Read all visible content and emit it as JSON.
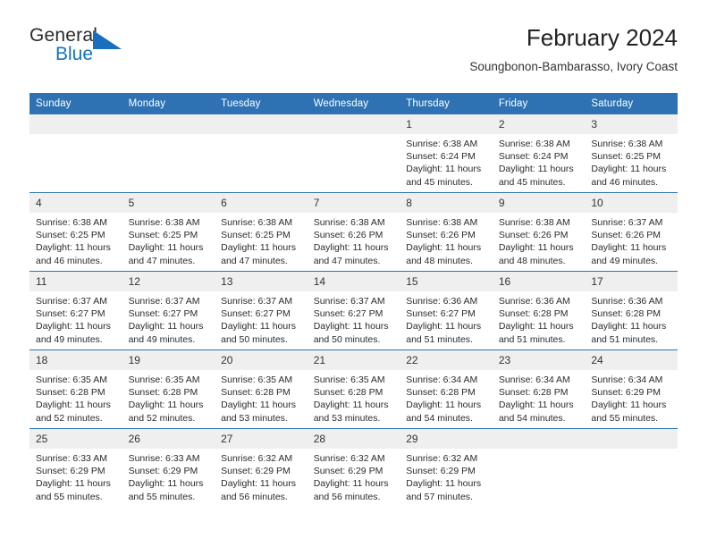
{
  "logo": {
    "word_one": "General",
    "word_two": "Blue",
    "accent_color": "#1a6fbd",
    "triangle_icon": "triangle-icon"
  },
  "header": {
    "title": "February 2024",
    "subtitle": "Soungbonon-Bambarasso, Ivory Coast"
  },
  "calendar": {
    "header_bg": "#2e72b3",
    "daynum_bg": "#efefef",
    "weekdays": [
      "Sunday",
      "Monday",
      "Tuesday",
      "Wednesday",
      "Thursday",
      "Friday",
      "Saturday"
    ],
    "weeks": [
      [
        {
          "day": "",
          "empty": true
        },
        {
          "day": "",
          "empty": true
        },
        {
          "day": "",
          "empty": true
        },
        {
          "day": "",
          "empty": true
        },
        {
          "day": "1",
          "sunrise": "Sunrise: 6:38 AM",
          "sunset": "Sunset: 6:24 PM",
          "daylight_l1": "Daylight: 11 hours",
          "daylight_l2": "and 45 minutes."
        },
        {
          "day": "2",
          "sunrise": "Sunrise: 6:38 AM",
          "sunset": "Sunset: 6:24 PM",
          "daylight_l1": "Daylight: 11 hours",
          "daylight_l2": "and 45 minutes."
        },
        {
          "day": "3",
          "sunrise": "Sunrise: 6:38 AM",
          "sunset": "Sunset: 6:25 PM",
          "daylight_l1": "Daylight: 11 hours",
          "daylight_l2": "and 46 minutes."
        }
      ],
      [
        {
          "day": "4",
          "sunrise": "Sunrise: 6:38 AM",
          "sunset": "Sunset: 6:25 PM",
          "daylight_l1": "Daylight: 11 hours",
          "daylight_l2": "and 46 minutes."
        },
        {
          "day": "5",
          "sunrise": "Sunrise: 6:38 AM",
          "sunset": "Sunset: 6:25 PM",
          "daylight_l1": "Daylight: 11 hours",
          "daylight_l2": "and 47 minutes."
        },
        {
          "day": "6",
          "sunrise": "Sunrise: 6:38 AM",
          "sunset": "Sunset: 6:25 PM",
          "daylight_l1": "Daylight: 11 hours",
          "daylight_l2": "and 47 minutes."
        },
        {
          "day": "7",
          "sunrise": "Sunrise: 6:38 AM",
          "sunset": "Sunset: 6:26 PM",
          "daylight_l1": "Daylight: 11 hours",
          "daylight_l2": "and 47 minutes."
        },
        {
          "day": "8",
          "sunrise": "Sunrise: 6:38 AM",
          "sunset": "Sunset: 6:26 PM",
          "daylight_l1": "Daylight: 11 hours",
          "daylight_l2": "and 48 minutes."
        },
        {
          "day": "9",
          "sunrise": "Sunrise: 6:38 AM",
          "sunset": "Sunset: 6:26 PM",
          "daylight_l1": "Daylight: 11 hours",
          "daylight_l2": "and 48 minutes."
        },
        {
          "day": "10",
          "sunrise": "Sunrise: 6:37 AM",
          "sunset": "Sunset: 6:26 PM",
          "daylight_l1": "Daylight: 11 hours",
          "daylight_l2": "and 49 minutes."
        }
      ],
      [
        {
          "day": "11",
          "sunrise": "Sunrise: 6:37 AM",
          "sunset": "Sunset: 6:27 PM",
          "daylight_l1": "Daylight: 11 hours",
          "daylight_l2": "and 49 minutes."
        },
        {
          "day": "12",
          "sunrise": "Sunrise: 6:37 AM",
          "sunset": "Sunset: 6:27 PM",
          "daylight_l1": "Daylight: 11 hours",
          "daylight_l2": "and 49 minutes."
        },
        {
          "day": "13",
          "sunrise": "Sunrise: 6:37 AM",
          "sunset": "Sunset: 6:27 PM",
          "daylight_l1": "Daylight: 11 hours",
          "daylight_l2": "and 50 minutes."
        },
        {
          "day": "14",
          "sunrise": "Sunrise: 6:37 AM",
          "sunset": "Sunset: 6:27 PM",
          "daylight_l1": "Daylight: 11 hours",
          "daylight_l2": "and 50 minutes."
        },
        {
          "day": "15",
          "sunrise": "Sunrise: 6:36 AM",
          "sunset": "Sunset: 6:27 PM",
          "daylight_l1": "Daylight: 11 hours",
          "daylight_l2": "and 51 minutes."
        },
        {
          "day": "16",
          "sunrise": "Sunrise: 6:36 AM",
          "sunset": "Sunset: 6:28 PM",
          "daylight_l1": "Daylight: 11 hours",
          "daylight_l2": "and 51 minutes."
        },
        {
          "day": "17",
          "sunrise": "Sunrise: 6:36 AM",
          "sunset": "Sunset: 6:28 PM",
          "daylight_l1": "Daylight: 11 hours",
          "daylight_l2": "and 51 minutes."
        }
      ],
      [
        {
          "day": "18",
          "sunrise": "Sunrise: 6:35 AM",
          "sunset": "Sunset: 6:28 PM",
          "daylight_l1": "Daylight: 11 hours",
          "daylight_l2": "and 52 minutes."
        },
        {
          "day": "19",
          "sunrise": "Sunrise: 6:35 AM",
          "sunset": "Sunset: 6:28 PM",
          "daylight_l1": "Daylight: 11 hours",
          "daylight_l2": "and 52 minutes."
        },
        {
          "day": "20",
          "sunrise": "Sunrise: 6:35 AM",
          "sunset": "Sunset: 6:28 PM",
          "daylight_l1": "Daylight: 11 hours",
          "daylight_l2": "and 53 minutes."
        },
        {
          "day": "21",
          "sunrise": "Sunrise: 6:35 AM",
          "sunset": "Sunset: 6:28 PM",
          "daylight_l1": "Daylight: 11 hours",
          "daylight_l2": "and 53 minutes."
        },
        {
          "day": "22",
          "sunrise": "Sunrise: 6:34 AM",
          "sunset": "Sunset: 6:28 PM",
          "daylight_l1": "Daylight: 11 hours",
          "daylight_l2": "and 54 minutes."
        },
        {
          "day": "23",
          "sunrise": "Sunrise: 6:34 AM",
          "sunset": "Sunset: 6:28 PM",
          "daylight_l1": "Daylight: 11 hours",
          "daylight_l2": "and 54 minutes."
        },
        {
          "day": "24",
          "sunrise": "Sunrise: 6:34 AM",
          "sunset": "Sunset: 6:29 PM",
          "daylight_l1": "Daylight: 11 hours",
          "daylight_l2": "and 55 minutes."
        }
      ],
      [
        {
          "day": "25",
          "sunrise": "Sunrise: 6:33 AM",
          "sunset": "Sunset: 6:29 PM",
          "daylight_l1": "Daylight: 11 hours",
          "daylight_l2": "and 55 minutes."
        },
        {
          "day": "26",
          "sunrise": "Sunrise: 6:33 AM",
          "sunset": "Sunset: 6:29 PM",
          "daylight_l1": "Daylight: 11 hours",
          "daylight_l2": "and 55 minutes."
        },
        {
          "day": "27",
          "sunrise": "Sunrise: 6:32 AM",
          "sunset": "Sunset: 6:29 PM",
          "daylight_l1": "Daylight: 11 hours",
          "daylight_l2": "and 56 minutes."
        },
        {
          "day": "28",
          "sunrise": "Sunrise: 6:32 AM",
          "sunset": "Sunset: 6:29 PM",
          "daylight_l1": "Daylight: 11 hours",
          "daylight_l2": "and 56 minutes."
        },
        {
          "day": "29",
          "sunrise": "Sunrise: 6:32 AM",
          "sunset": "Sunset: 6:29 PM",
          "daylight_l1": "Daylight: 11 hours",
          "daylight_l2": "and 57 minutes."
        },
        {
          "day": "",
          "empty": true
        },
        {
          "day": "",
          "empty": true
        }
      ]
    ]
  }
}
